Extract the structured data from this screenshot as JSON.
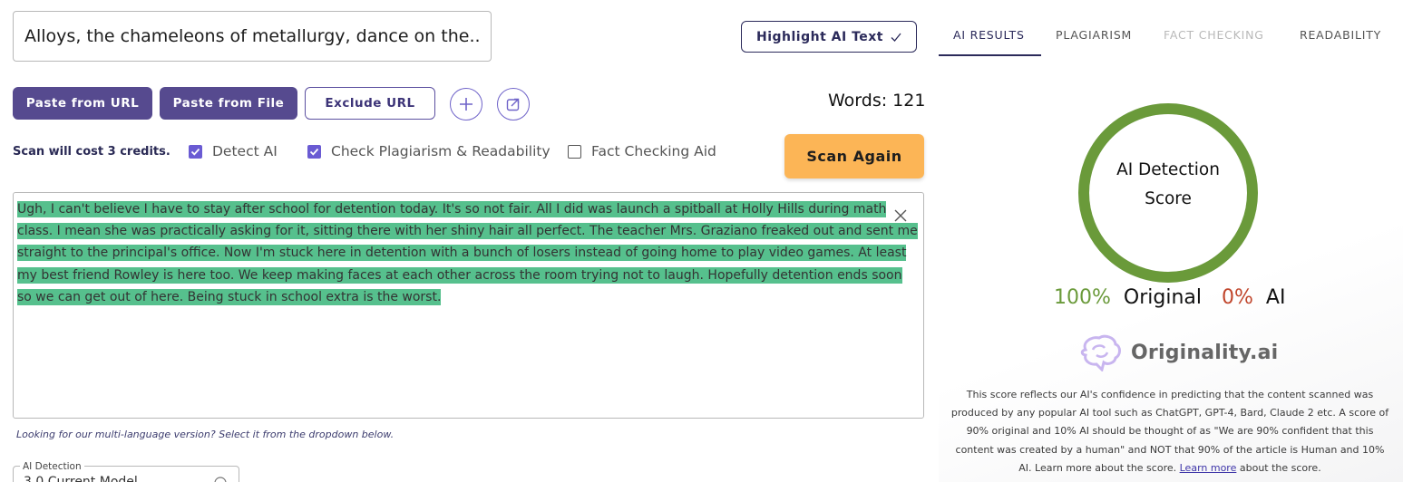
{
  "editor_header": {
    "title_value": "Alloys, the chameleons of metallurgy, dance on the...",
    "highlight_label": "Highlight AI Text"
  },
  "toolbar": {
    "paste_url": "Paste from URL",
    "paste_file": "Paste from File",
    "exclude_url": "Exclude URL",
    "words_label": "Words: 121"
  },
  "options": {
    "cost": "Scan will cost 3 credits.",
    "detect_ai": "Detect AI",
    "check_plag": "Check Plagiarism & Readability",
    "fact_check": "Fact Checking Aid",
    "scan_again": "Scan Again"
  },
  "content": {
    "text": "Ugh, I can't believe I have to stay after school for detention today. It's so not fair. All I did was launch a spitball at Holly Hills during math class. I mean she was practically asking for it, sitting there with her shiny hair all perfect. The teacher Mrs. Graziano freaked out and sent me straight to the principal's office. Now I'm stuck here in detention with a bunch of losers instead of going home to play video games. At least my best friend Rowley is here too. We keep making faces at each other across the room trying not to laugh. Hopefully detention ends soon so we can get out of here. Being stuck in school extra is the worst."
  },
  "footer": {
    "multi_lang": "Looking for our multi-language version? Select it from the dropdown below.",
    "model_legend": "AI Detection",
    "model_value": "3.0 Current Model"
  },
  "results": {
    "tabs": [
      {
        "label": "AI RESULTS"
      },
      {
        "label": "PLAGIARISM"
      },
      {
        "label": "FACT CHECKING"
      },
      {
        "label": "READABILITY"
      }
    ],
    "gauge_line1": "AI Detection",
    "gauge_line2": "Score",
    "original_pct": "100%",
    "original_label": "Original",
    "ai_pct": "0%",
    "ai_label": "AI",
    "original_fraction": 1.0,
    "brand": "Originality.ai",
    "disclaimer_text": "This score reflects our AI's confidence in predicting that the content scanned was produced by any popular AI tool such as ChatGPT, GPT-4, Bard, Claude 2 etc. A score of 90% original and 10% AI should be thought of as \"We are 90% confident that this content was created by a human\" and NOT that 90% of the article is Human and 10% AI. Learn more about the score.",
    "learn_more": "Learn more",
    "disclaimer_tail": "about the score."
  },
  "colors": {
    "primary": "#564a8f",
    "accent_orange": "#fcb556",
    "gauge_green": "#6a9a3a",
    "highlight_green": "#56c08d",
    "ai_red": "#c0452b"
  },
  "icons": {
    "plus": "plus-icon",
    "share": "share-icon",
    "check": "check-icon",
    "close": "close-icon",
    "brain": "brain-logo-icon",
    "info": "info-icon"
  }
}
